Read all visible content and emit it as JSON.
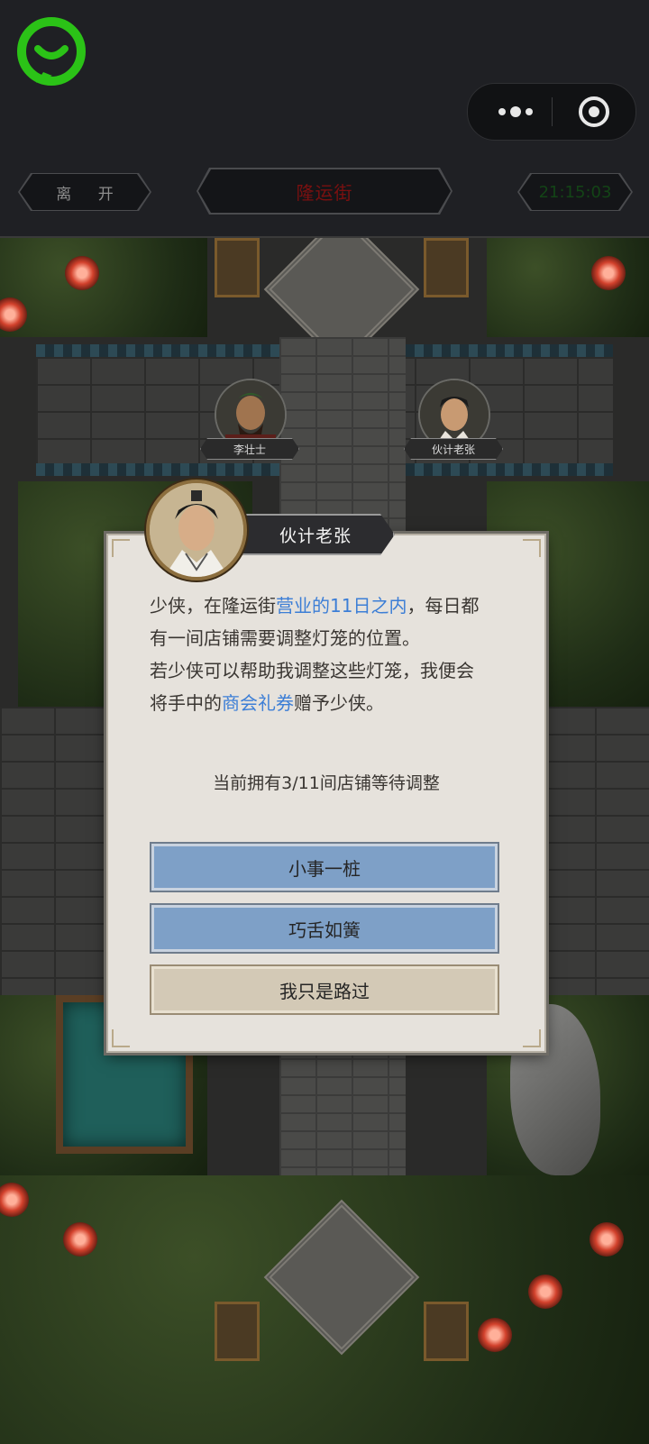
{
  "header": {
    "leave_label": "离 开",
    "location_title": "隆运街",
    "clock": "21:15:03"
  },
  "map": {
    "npcs": [
      {
        "name": "李壮士"
      },
      {
        "name": "伙计老张"
      }
    ]
  },
  "dialog": {
    "speaker": "伙计老张",
    "line1_a": "少侠，在隆运街",
    "line1_hl": "营业的11日之内",
    "line1_b": "，每日都",
    "line2": "有一间店铺需要调整灯笼的位置。",
    "line3": "若少侠可以帮助我调整这些灯笼，我便会",
    "line4_a": "将手中的",
    "line4_hl": "商会礼券",
    "line4_b": "赠予少侠。",
    "status": "当前拥有3/11间店铺等待调整",
    "options": [
      "小事一桩",
      "巧舌如簧",
      "我只是路过"
    ]
  },
  "colors": {
    "highlight": "#3c7ed6",
    "option_blue": "#7ea0c7",
    "option_tan": "#d3c9b6",
    "app_logo_green": "#2bc217"
  },
  "icons": [
    "app-logo-icon",
    "more-dots-icon",
    "close-target-icon"
  ]
}
